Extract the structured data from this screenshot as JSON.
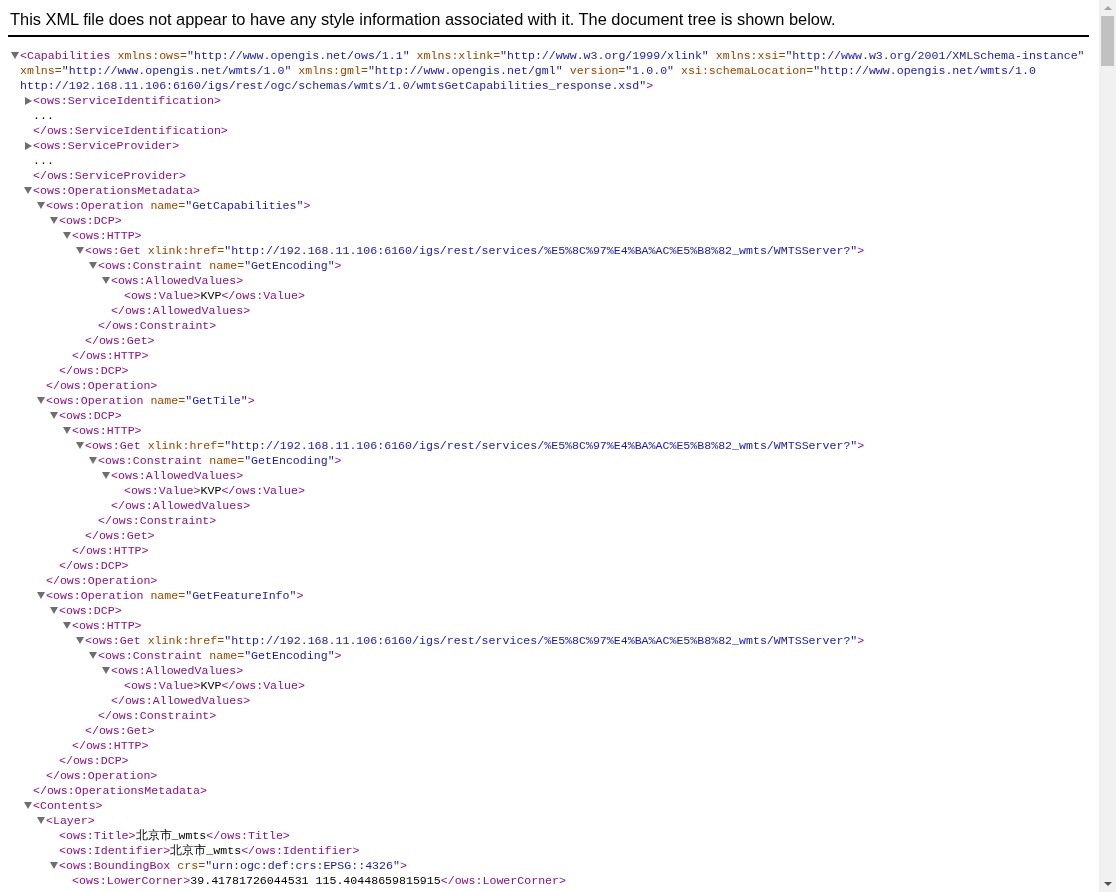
{
  "notice": "This XML file does not appear to have any style information associated with it. The document tree is shown below.",
  "tree": {
    "kind": "element",
    "open": "<Capabilities",
    "attributes": [
      {
        "name": "xmlns:ows=",
        "value": "\"http://www.opengis.net/ows/1.1\""
      },
      {
        "name": "xmlns:xlink=",
        "value": "\"http://www.w3.org/1999/xlink\""
      },
      {
        "name": "xmlns:xsi=",
        "value": "\"http://www.w3.org/2001/XMLSchema-instance\""
      },
      {
        "name": "xmlns=",
        "value": "\"http://www.opengis.net/wmts/1.0\""
      },
      {
        "name": "xmlns:gml=",
        "value": "\"http://www.opengis.net/gml\""
      },
      {
        "name": "version=",
        "value": "\"1.0.0\""
      },
      {
        "name": "xsi:schemaLocation=",
        "value": "\"http://www.opengis.net/wmts/1.0 http://192.168.11.106:6160/igs/rest/ogc/schemas/wmts/1.0/wmtsGetCapabilities_response.xsd\""
      }
    ],
    "open_end": ">",
    "expanded": true,
    "children": [
      {
        "kind": "element",
        "open": "<ows:ServiceIdentification>",
        "expanded": false,
        "ellipsis": "...",
        "close": "</ows:ServiceIdentification>"
      },
      {
        "kind": "element",
        "open": "<ows:ServiceProvider>",
        "expanded": false,
        "ellipsis": "...",
        "close": "</ows:ServiceProvider>"
      },
      {
        "kind": "element",
        "open": "<ows:OperationsMetadata>",
        "expanded": true,
        "children": [
          {
            "kind": "element",
            "open": "<ows:Operation",
            "attributes": [
              {
                "name": "name=",
                "value": "\"GetCapabilities\""
              }
            ],
            "open_end": ">",
            "expanded": true,
            "children": [
              {
                "kind": "element",
                "open": "<ows:DCP>",
                "expanded": true,
                "children": [
                  {
                    "kind": "element",
                    "open": "<ows:HTTP>",
                    "expanded": true,
                    "children": [
                      {
                        "kind": "element",
                        "open": "<ows:Get",
                        "attributes": [
                          {
                            "name": "xlink:href=",
                            "value": "\"http://192.168.11.106:6160/igs/rest/services/%E5%8C%97%E4%BA%AC%E5%B8%82_wmts/WMTSServer?\""
                          }
                        ],
                        "open_end": ">",
                        "expanded": true,
                        "children": [
                          {
                            "kind": "element",
                            "open": "<ows:Constraint",
                            "attributes": [
                              {
                                "name": "name=",
                                "value": "\"GetEncoding\""
                              }
                            ],
                            "open_end": ">",
                            "expanded": true,
                            "children": [
                              {
                                "kind": "element",
                                "open": "<ows:AllowedValues>",
                                "expanded": true,
                                "children": [
                                  {
                                    "kind": "leaf",
                                    "open": "<ows:Value>",
                                    "text": "KVP",
                                    "close": "</ows:Value>"
                                  }
                                ],
                                "close": "</ows:AllowedValues>"
                              }
                            ],
                            "close": "</ows:Constraint>"
                          }
                        ],
                        "close": "</ows:Get>"
                      }
                    ],
                    "close": "</ows:HTTP>"
                  }
                ],
                "close": "</ows:DCP>"
              }
            ],
            "close": "</ows:Operation>"
          },
          {
            "kind": "element",
            "open": "<ows:Operation",
            "attributes": [
              {
                "name": "name=",
                "value": "\"GetTile\""
              }
            ],
            "open_end": ">",
            "expanded": true,
            "children": [
              {
                "kind": "element",
                "open": "<ows:DCP>",
                "expanded": true,
                "children": [
                  {
                    "kind": "element",
                    "open": "<ows:HTTP>",
                    "expanded": true,
                    "children": [
                      {
                        "kind": "element",
                        "open": "<ows:Get",
                        "attributes": [
                          {
                            "name": "xlink:href=",
                            "value": "\"http://192.168.11.106:6160/igs/rest/services/%E5%8C%97%E4%BA%AC%E5%B8%82_wmts/WMTSServer?\""
                          }
                        ],
                        "open_end": ">",
                        "expanded": true,
                        "children": [
                          {
                            "kind": "element",
                            "open": "<ows:Constraint",
                            "attributes": [
                              {
                                "name": "name=",
                                "value": "\"GetEncoding\""
                              }
                            ],
                            "open_end": ">",
                            "expanded": true,
                            "children": [
                              {
                                "kind": "element",
                                "open": "<ows:AllowedValues>",
                                "expanded": true,
                                "children": [
                                  {
                                    "kind": "leaf",
                                    "open": "<ows:Value>",
                                    "text": "KVP",
                                    "close": "</ows:Value>"
                                  }
                                ],
                                "close": "</ows:AllowedValues>"
                              }
                            ],
                            "close": "</ows:Constraint>"
                          }
                        ],
                        "close": "</ows:Get>"
                      }
                    ],
                    "close": "</ows:HTTP>"
                  }
                ],
                "close": "</ows:DCP>"
              }
            ],
            "close": "</ows:Operation>"
          },
          {
            "kind": "element",
            "open": "<ows:Operation",
            "attributes": [
              {
                "name": "name=",
                "value": "\"GetFeatureInfo\""
              }
            ],
            "open_end": ">",
            "expanded": true,
            "children": [
              {
                "kind": "element",
                "open": "<ows:DCP>",
                "expanded": true,
                "children": [
                  {
                    "kind": "element",
                    "open": "<ows:HTTP>",
                    "expanded": true,
                    "children": [
                      {
                        "kind": "element",
                        "open": "<ows:Get",
                        "attributes": [
                          {
                            "name": "xlink:href=",
                            "value": "\"http://192.168.11.106:6160/igs/rest/services/%E5%8C%97%E4%BA%AC%E5%B8%82_wmts/WMTSServer?\""
                          }
                        ],
                        "open_end": ">",
                        "expanded": true,
                        "children": [
                          {
                            "kind": "element",
                            "open": "<ows:Constraint",
                            "attributes": [
                              {
                                "name": "name=",
                                "value": "\"GetEncoding\""
                              }
                            ],
                            "open_end": ">",
                            "expanded": true,
                            "children": [
                              {
                                "kind": "element",
                                "open": "<ows:AllowedValues>",
                                "expanded": true,
                                "children": [
                                  {
                                    "kind": "leaf",
                                    "open": "<ows:Value>",
                                    "text": "KVP",
                                    "close": "</ows:Value>"
                                  }
                                ],
                                "close": "</ows:AllowedValues>"
                              }
                            ],
                            "close": "</ows:Constraint>"
                          }
                        ],
                        "close": "</ows:Get>"
                      }
                    ],
                    "close": "</ows:HTTP>"
                  }
                ],
                "close": "</ows:DCP>"
              }
            ],
            "close": "</ows:Operation>"
          }
        ],
        "close": "</ows:OperationsMetadata>"
      },
      {
        "kind": "element",
        "open": "<Contents>",
        "expanded": true,
        "children": [
          {
            "kind": "element",
            "open": "<Layer>",
            "expanded": true,
            "children": [
              {
                "kind": "leaf",
                "open": "<ows:Title>",
                "text": "北京市_wmts",
                "close": "</ows:Title>"
              },
              {
                "kind": "leaf",
                "open": "<ows:Identifier>",
                "text": "北京市_wmts",
                "close": "</ows:Identifier>"
              },
              {
                "kind": "element",
                "open": "<ows:BoundingBox",
                "attributes": [
                  {
                    "name": "crs=",
                    "value": "\"urn:ogc:def:crs:EPSG::4326\""
                  }
                ],
                "open_end": ">",
                "expanded": true,
                "children": [
                  {
                    "kind": "leaf",
                    "open": "<ows:LowerCorner>",
                    "text": "39.41781726044531 115.40448659815915",
                    "close": "</ows:LowerCorner>"
                  }
                ]
              }
            ]
          }
        ]
      }
    ]
  }
}
